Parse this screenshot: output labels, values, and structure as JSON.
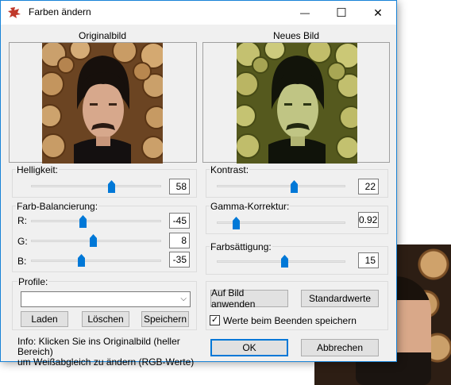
{
  "window": {
    "title": "Farben ändern",
    "minimize_glyph": "—",
    "maximize_glyph": "☐",
    "close_glyph": "✕"
  },
  "images": {
    "original_label": "Originalbild",
    "new_label": "Neues Bild"
  },
  "brightness": {
    "label": "Helligkeit:",
    "value": "58",
    "level": 0.62
  },
  "contrast": {
    "label": "Kontrast:",
    "value": "22",
    "level": 0.6
  },
  "color_balance": {
    "label": "Farb-Balancierung:",
    "r": {
      "label": "R:",
      "value": "-45",
      "level": 0.4
    },
    "g": {
      "label": "G:",
      "value": "8",
      "level": 0.48
    },
    "b": {
      "label": "B:",
      "value": "-35",
      "level": 0.39
    }
  },
  "gamma": {
    "label": "Gamma-Korrektur:",
    "value": "0.92",
    "level": 0.15
  },
  "saturation": {
    "label": "Farbsättigung:",
    "value": "15",
    "level": 0.53
  },
  "profiles": {
    "label": "Profile:",
    "selected": "",
    "load_label": "Laden",
    "delete_label": "Löschen",
    "save_label": "Speichern"
  },
  "actions": {
    "apply_label": "Auf Bild anwenden",
    "defaults_label": "Standardwerte",
    "save_on_exit_label": "Werte beim Beenden speichern",
    "save_on_exit_checked": true,
    "ok_label": "OK",
    "cancel_label": "Abbrechen"
  },
  "info": {
    "line1": "Info: Klicken Sie ins Originalbild (heller Bereich)",
    "line2": "um Weißabgleich zu ändern (RGB-Werte)"
  },
  "colors": {
    "accent": "#0078d7",
    "window_border": "#1883d7",
    "dialog_bg": "#f0f0f0"
  }
}
